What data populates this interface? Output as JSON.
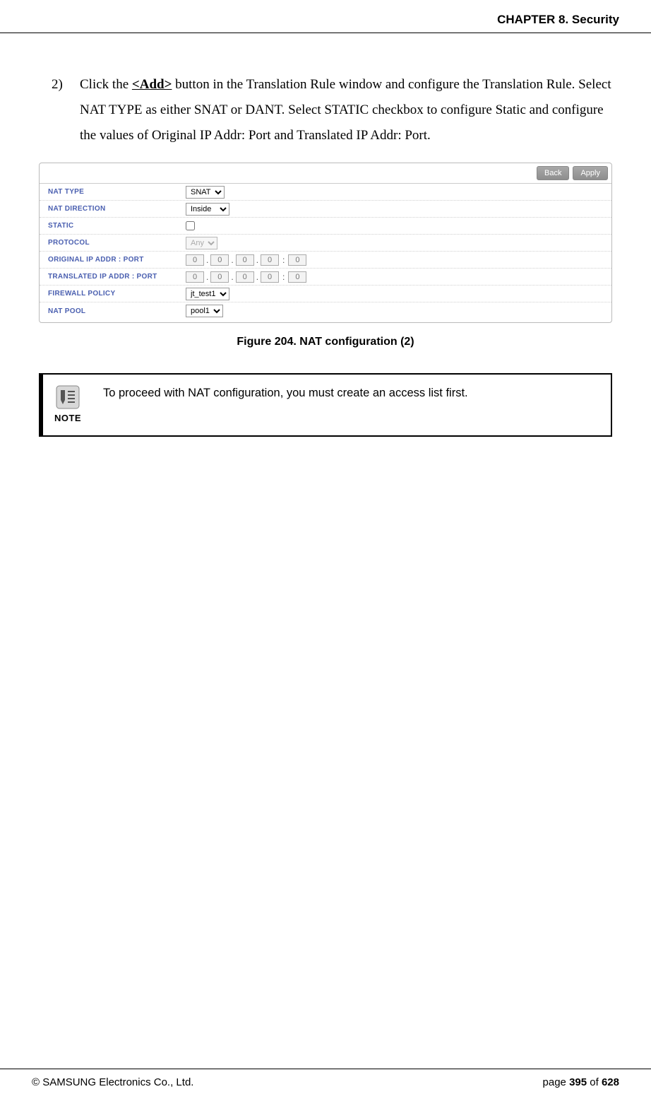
{
  "header": {
    "chapter": "CHAPTER 8. Security"
  },
  "step": {
    "number": "2)",
    "pre": "Click the ",
    "add": "<Add>",
    "post": " button in the Translation Rule window and configure the Translation Rule. Select NAT TYPE as either SNAT or DANT. Select STATIC checkbox to configure Static and configure the values of Original IP Addr: Port and Translated IP Addr: Port."
  },
  "figure": {
    "buttons": {
      "back": "Back",
      "apply": "Apply"
    },
    "rows": {
      "nat_type": {
        "label": "NAT TYPE",
        "value": "SNAT"
      },
      "nat_direction": {
        "label": "NAT DIRECTION",
        "value": "Inside"
      },
      "static": {
        "label": "STATIC",
        "checked": false
      },
      "protocol": {
        "label": "PROTOCOL",
        "value": "Any"
      },
      "orig": {
        "label": "ORIGINAL IP ADDR : PORT",
        "o1": "0",
        "o2": "0",
        "o3": "0",
        "o4": "0",
        "port": "0"
      },
      "trans": {
        "label": "TRANSLATED IP ADDR : PORT",
        "o1": "0",
        "o2": "0",
        "o3": "0",
        "o4": "0",
        "port": "0"
      },
      "firewall": {
        "label": "FIREWALL POLICY",
        "value": "jt_test1"
      },
      "nat_pool": {
        "label": "NAT POOL",
        "value": "pool1"
      }
    },
    "caption": "Figure 204. NAT configuration (2)"
  },
  "note": {
    "label": "NOTE",
    "text": "To proceed with NAT configuration, you must create an access list first."
  },
  "footer": {
    "copyright": "© SAMSUNG Electronics Co., Ltd.",
    "page_prefix": "page ",
    "page_num": "395",
    "page_of": " of ",
    "page_total": "628"
  }
}
